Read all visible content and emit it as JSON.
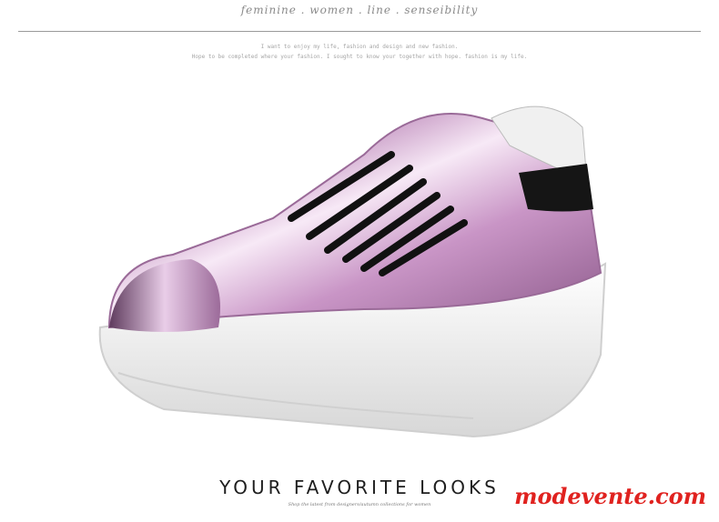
{
  "header": {
    "tagline": "feminine . women . line . senseibility",
    "note_line1": "I want to enjoy my life, fashion and design and new fashion.",
    "note_line2": "Hope to be completed where your fashion. I sought to know your together with hope. fashion is my life."
  },
  "product": {
    "icon": "sneaker-icon",
    "upper_color": "#d8a8d6",
    "lace_color": "#111111",
    "sole_color": "#f2f2f2"
  },
  "footer": {
    "headline": "YOUR FAVORITE LOOKS",
    "subline": "Shop the latest from designers/autumn collections for women",
    "brand": "modevente.com",
    "brand_color": "#e0221f"
  }
}
